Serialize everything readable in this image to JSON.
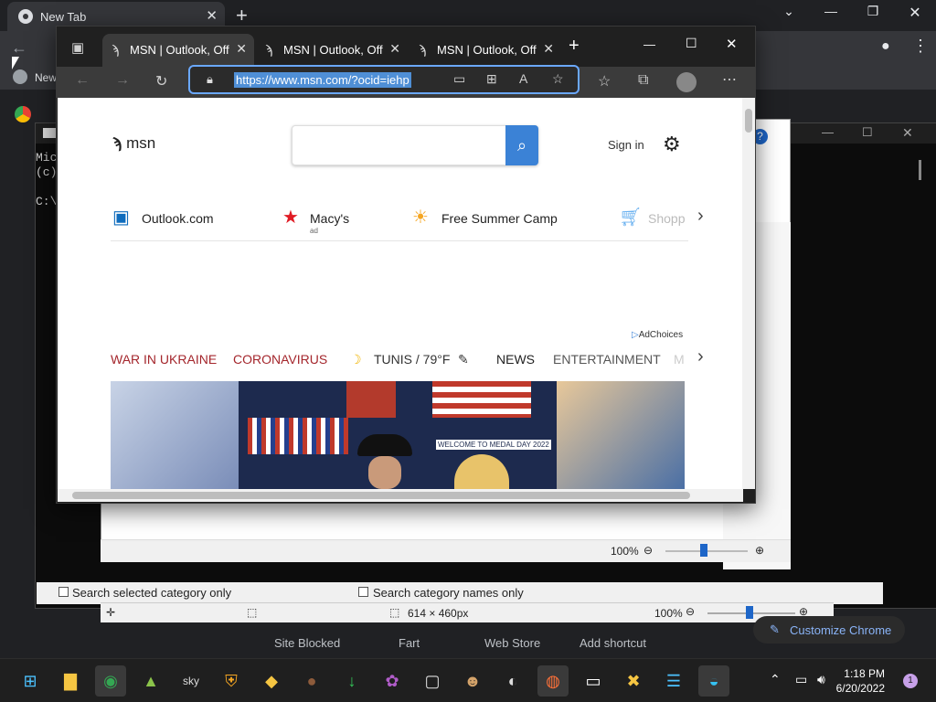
{
  "chrome": {
    "tab_title": "New Tab",
    "bookmark_label": "New",
    "shortcuts": [
      "Site Blocked",
      "Fart",
      "Web Store",
      "Add shortcut"
    ],
    "customize": "Customize Chrome"
  },
  "console": {
    "lines": [
      "Mic",
      "(c)",
      "",
      "C:\\"
    ]
  },
  "doc": {
    "zoom": "100%"
  },
  "paint": {
    "checkbox1": "Search selected category only",
    "checkbox2": "Search category names only",
    "dimensions": "614 × 460px",
    "zoom": "100%"
  },
  "edge": {
    "tabs": [
      {
        "title": "MSN | Outlook, Off"
      },
      {
        "title": "MSN | Outlook, Off"
      },
      {
        "title": "MSN | Outlook, Off"
      }
    ],
    "url": "https://www.msn.com/?ocid=iehp"
  },
  "msn": {
    "logo": "msn",
    "sign_in": "Sign in",
    "quick_links": [
      {
        "label": "Outlook.com"
      },
      {
        "label": "Macy's",
        "sub": "ad"
      },
      {
        "label": "Free Summer Camp"
      },
      {
        "label": "Shopp"
      }
    ],
    "adchoices": "AdChoices",
    "nav": [
      "WAR IN UKRAINE",
      "CORONAVIRUS",
      "TUNIS / 79°F",
      "NEWS",
      "ENTERTAINMENT",
      "M"
    ],
    "hero_banner": "WELCOME TO MEDAL DAY 2022"
  },
  "taskbar": {
    "time": "1:18 PM",
    "date": "6/20/2022",
    "notifications": "1"
  },
  "colors": {
    "edge_accent": "#6aa8ff",
    "msn_search": "#3b82d6",
    "nav_red": "#a4262c"
  }
}
